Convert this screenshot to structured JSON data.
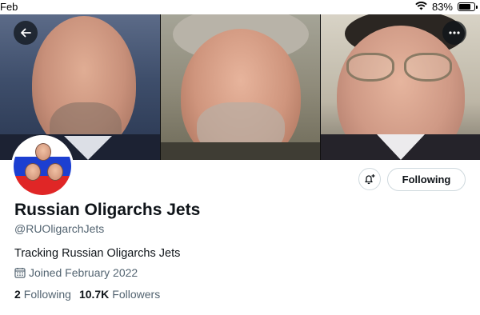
{
  "status_bar": {
    "date_fragment": "Feb",
    "battery_text": "83%",
    "battery_level": 0.83
  },
  "profile": {
    "display_name": "Russian Oligarchs Jets",
    "handle": "@RUOligarchJets",
    "bio": "Tracking Russian Oligarchs Jets",
    "joined": "Joined February 2022",
    "following_count": "2",
    "following_label": "Following",
    "followers_count": "10.7K",
    "followers_label": "Followers"
  },
  "actions": {
    "following_button_label": "Following"
  },
  "icons": {
    "back": "arrow-left-icon",
    "more": "more-dots-icon",
    "notify": "bell-plus-icon",
    "calendar": "calendar-icon",
    "wifi": "wifi-icon",
    "battery": "battery-icon"
  },
  "colors": {
    "text_primary": "#0f1419",
    "text_secondary": "#536471",
    "border": "#cfd9de",
    "flag_blue": "#1c3fd1",
    "flag_red": "#e02626"
  }
}
